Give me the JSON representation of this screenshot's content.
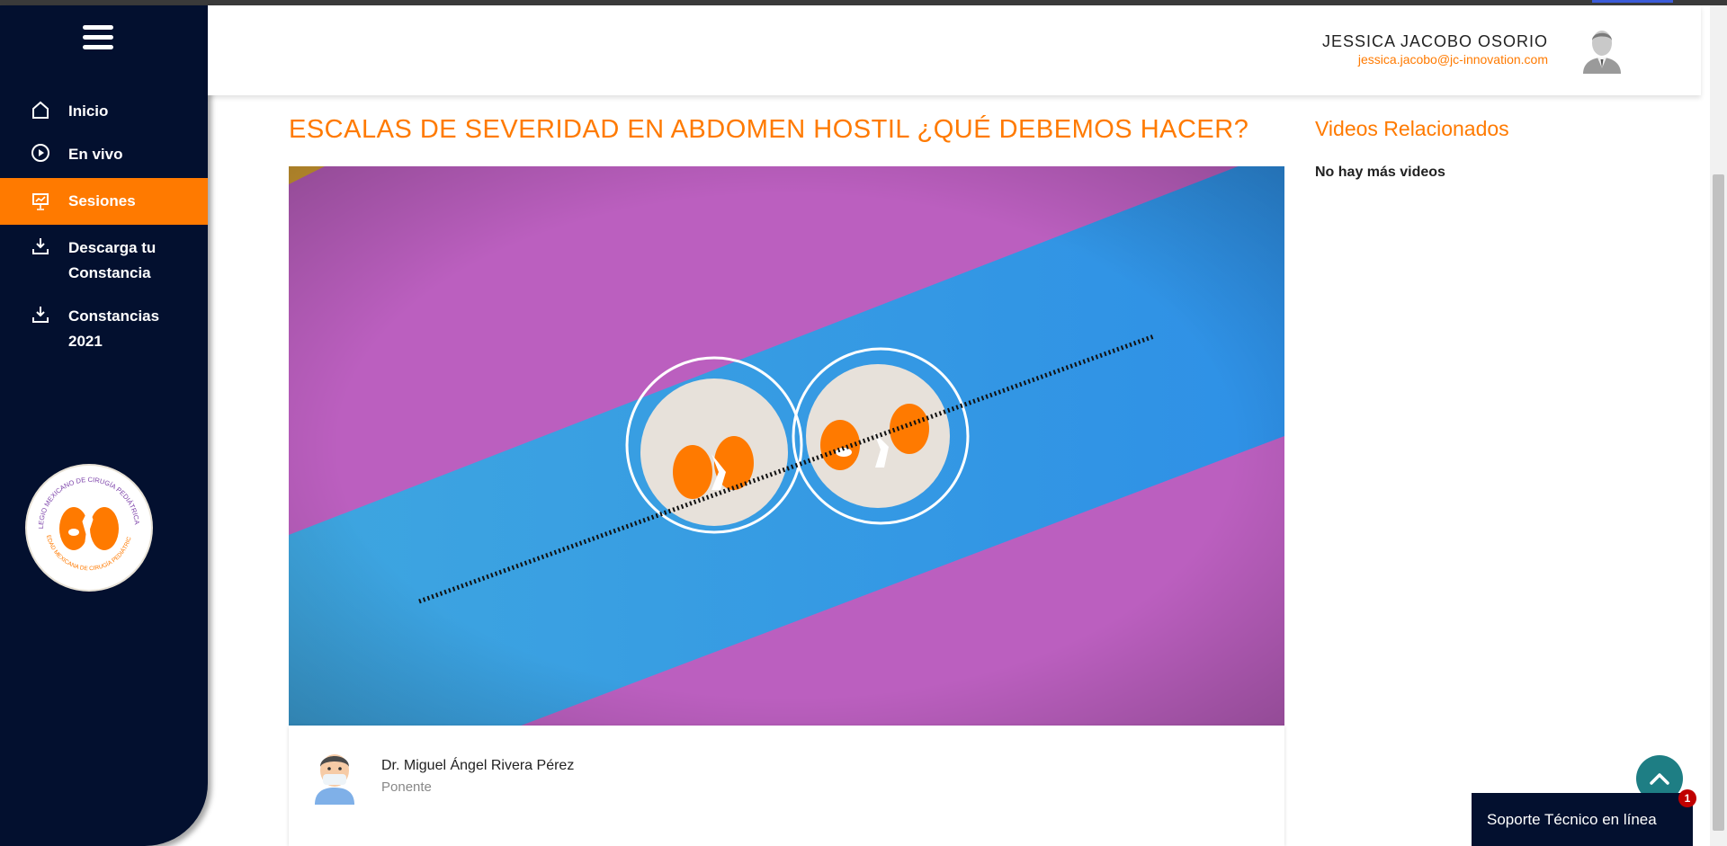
{
  "sidebar": {
    "menu_icon": "hamburger-icon",
    "items": [
      {
        "label": "Inicio",
        "icon": "home-icon",
        "active": false
      },
      {
        "label": "En vivo",
        "icon": "play-circle-icon",
        "active": false
      },
      {
        "label": "Sesiones",
        "icon": "presentation-icon",
        "active": true
      },
      {
        "label": "Descarga tu Constancia",
        "icon": "download-icon",
        "active": false
      },
      {
        "label": "Constancias 2021",
        "icon": "download-icon",
        "active": false
      }
    ],
    "logo_text_top": "COLEGIO MEXICANO DE CIRUGÍA PEDIÁTRICA A.C.",
    "logo_text_bottom": "SOCIEDAD MEXICANA DE CIRUGÍA PEDIÁTRICA A.C."
  },
  "header": {
    "user_name": "JESSICA JACOBO OSORIO",
    "user_email": "jessica.jacobo@jc-innovation.com",
    "avatar_icon": "user-avatar-icon"
  },
  "main": {
    "title": "ESCALAS DE SEVERIDAD EN ABDOMEN HOSTIL ¿QUÉ DEBEMOS HACER?",
    "speaker": {
      "name": "Dr. Miguel Ángel Rivera Pérez",
      "role": "Ponente"
    }
  },
  "related": {
    "title": "Videos Relacionados",
    "empty_text": "No hay más videos"
  },
  "support": {
    "label": "Soporte Técnico en línea",
    "badge_count": "1"
  },
  "colors": {
    "accent": "#ff7a00",
    "sidebar_bg": "#03102f",
    "scroll_top_bg": "#1e7e84",
    "badge": "#c00000"
  }
}
